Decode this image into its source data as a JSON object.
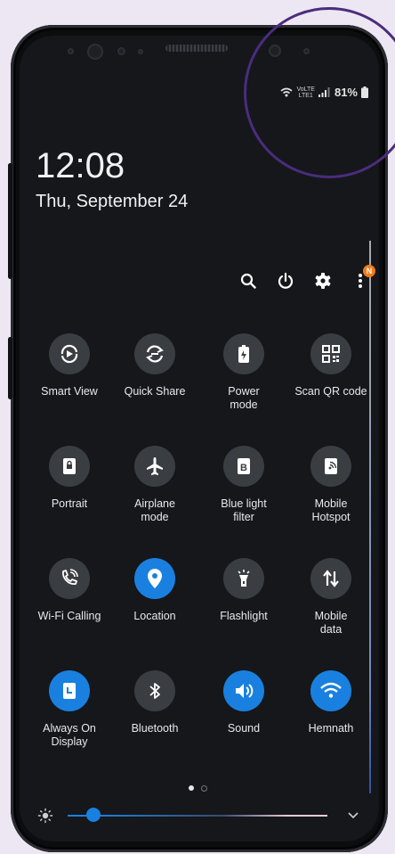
{
  "status_bar": {
    "battery_percent": "81%",
    "network_label_top": "VoLTE",
    "network_label_bottom": "LTE1"
  },
  "lockscreen": {
    "time": "12:08",
    "date": "Thu, September 24"
  },
  "quick_actions": {
    "notification_count": "N"
  },
  "tiles": [
    {
      "label": "Smart View",
      "icon": "smart-view-icon",
      "active": false
    },
    {
      "label": "Quick Share",
      "icon": "quick-share-icon",
      "active": false
    },
    {
      "label": "Power\nmode",
      "icon": "power-mode-icon",
      "active": false
    },
    {
      "label": "Scan QR code",
      "icon": "qr-code-icon",
      "active": false
    },
    {
      "label": "Portrait",
      "icon": "portrait-lock-icon",
      "active": false
    },
    {
      "label": "Airplane\nmode",
      "icon": "airplane-icon",
      "active": false
    },
    {
      "label": "Blue light\nfilter",
      "icon": "blue-light-icon",
      "active": false
    },
    {
      "label": "Mobile\nHotspot",
      "icon": "hotspot-icon",
      "active": false
    },
    {
      "label": "Wi-Fi Calling",
      "icon": "wifi-calling-icon",
      "active": false
    },
    {
      "label": "Location",
      "icon": "location-icon",
      "active": true
    },
    {
      "label": "Flashlight",
      "icon": "flashlight-icon",
      "active": false
    },
    {
      "label": "Mobile\ndata",
      "icon": "mobile-data-icon",
      "active": false
    },
    {
      "label": "Always On\nDisplay",
      "icon": "always-on-display-icon",
      "active": true
    },
    {
      "label": "Bluetooth",
      "icon": "bluetooth-icon",
      "active": false
    },
    {
      "label": "Sound",
      "icon": "sound-icon",
      "active": true
    },
    {
      "label": "Hemnath",
      "icon": "wifi-icon",
      "active": true
    }
  ],
  "brightness": {
    "level": 0.1
  },
  "page_indicator": {
    "current": 1,
    "total": 2
  },
  "colors": {
    "accent": "#1a80e0",
    "tile_inactive": "#3a3d41",
    "highlight_ring": "#4b2c7d",
    "badge": "#f07b1a"
  }
}
